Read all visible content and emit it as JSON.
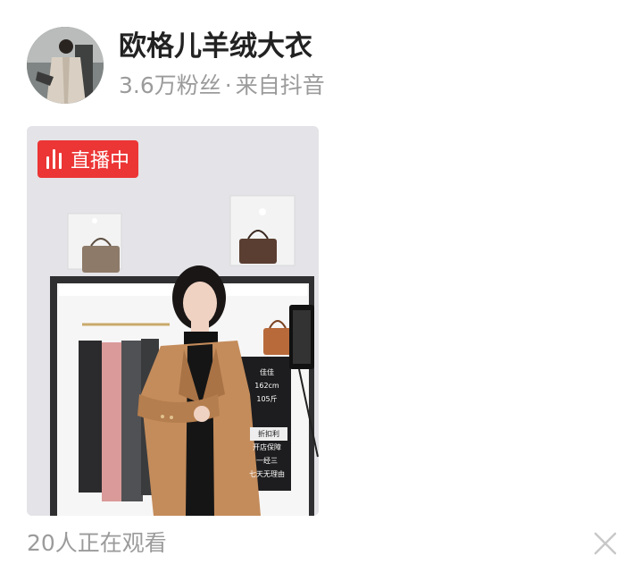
{
  "account": {
    "name": "欧格儿羊绒大衣",
    "followers": "3.6万粉丝",
    "separator": "·",
    "source": "来自抖音"
  },
  "live": {
    "badge_label": "直播中",
    "badge_icon": "live-bars-icon",
    "badge_color": "#ec3535"
  },
  "stream_scene": {
    "sign_lines": [
      "佳佳",
      "162cm",
      "105斤",
      "折扣利",
      "开店保障",
      "一经三",
      "七天无理由"
    ]
  },
  "footer": {
    "viewers": "20人正在观看",
    "close_icon": "close-icon"
  }
}
